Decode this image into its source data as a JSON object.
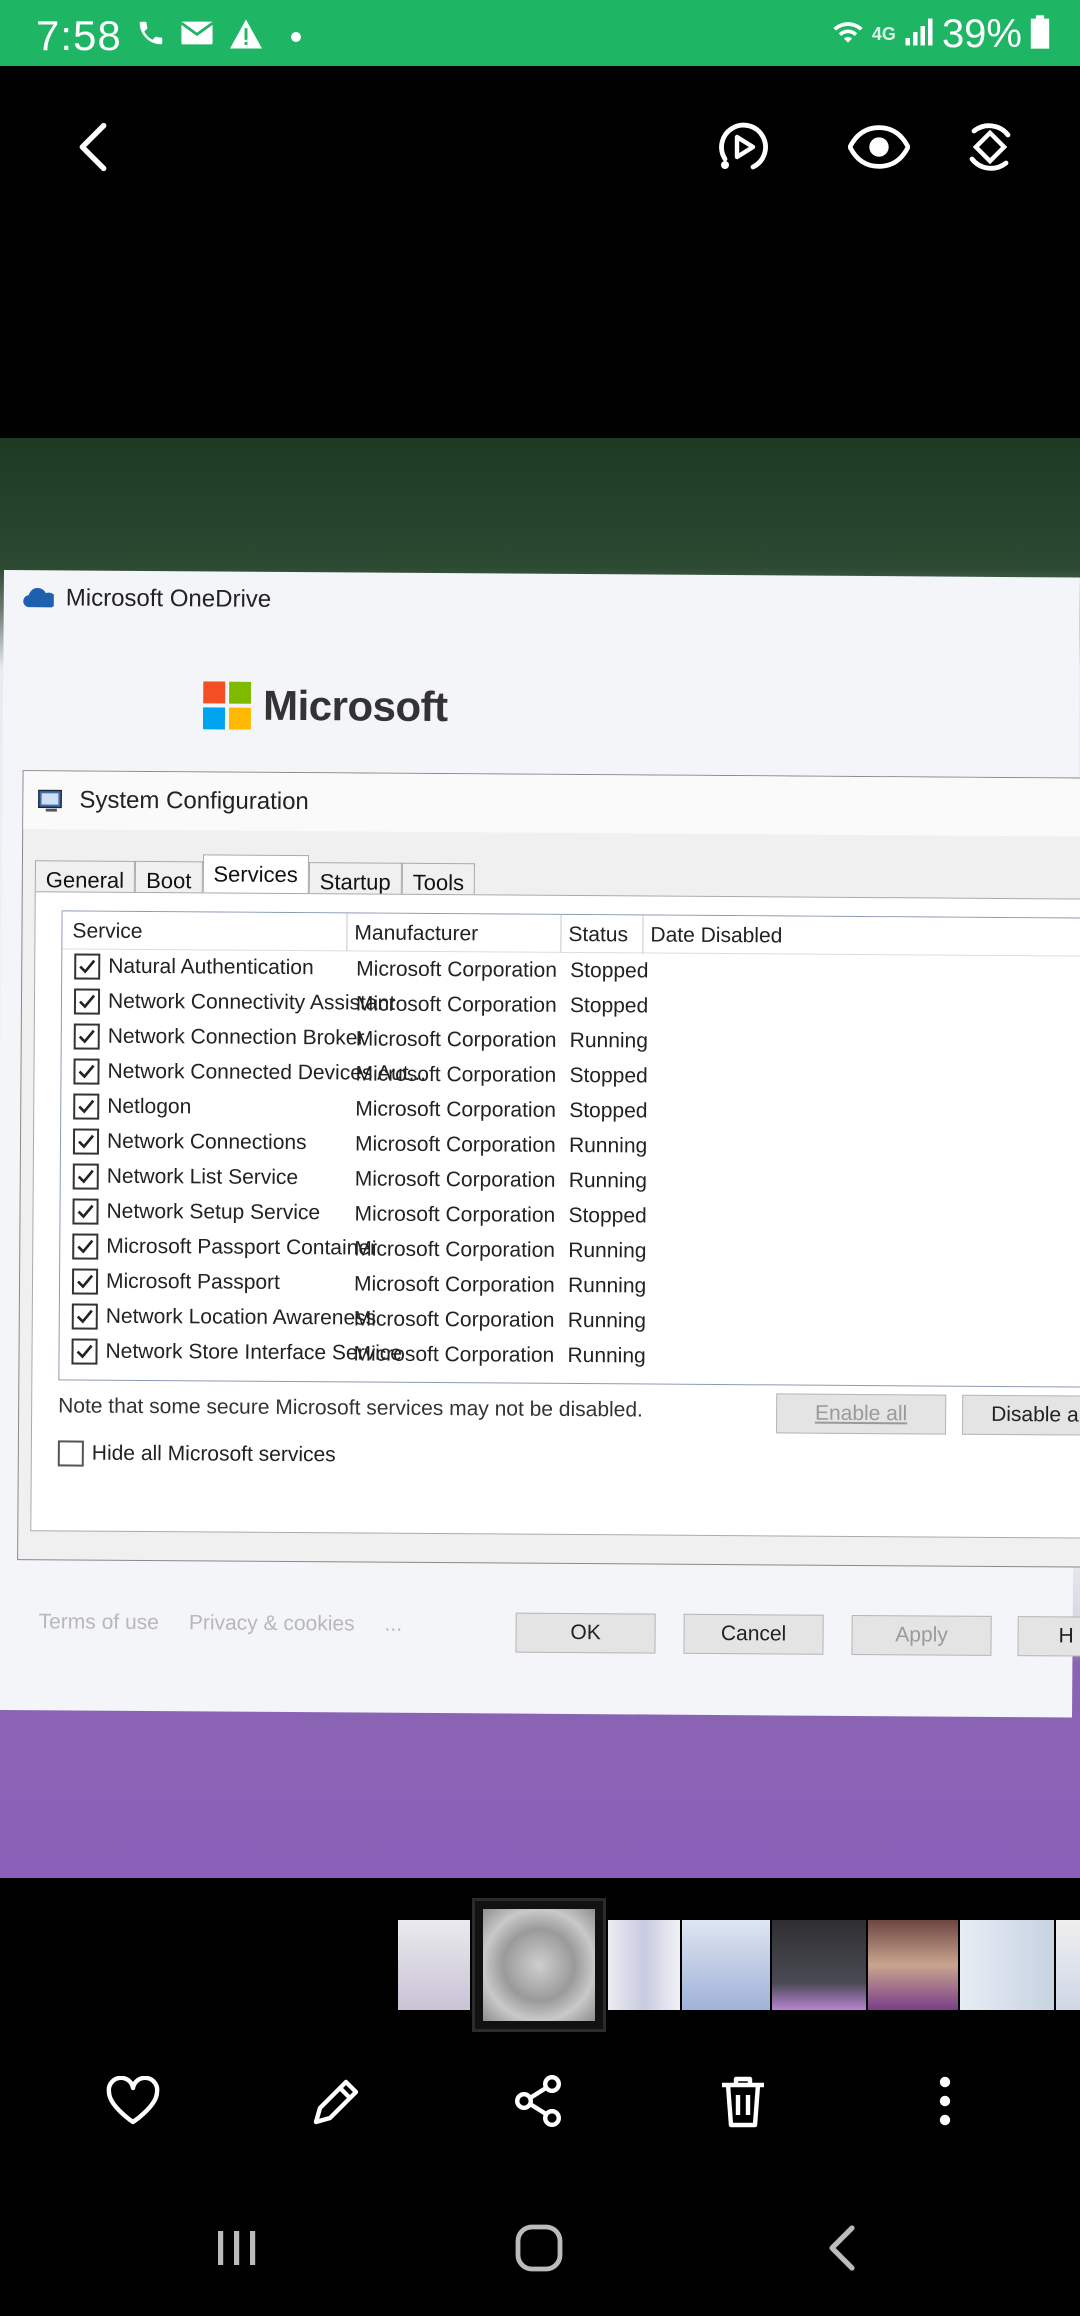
{
  "status_bar": {
    "time": "7:58",
    "network": "4G",
    "battery": "39%"
  },
  "viewer": {
    "back_icon": "chevron-left-icon",
    "actions": [
      "motion-photo-icon",
      "eye-icon",
      "rotate-icon"
    ]
  },
  "photo": {
    "onedrive_title": "Microsoft OneDrive",
    "ms_logo_text": "Microsoft",
    "dialog": {
      "title": "System Configuration",
      "tabs": [
        {
          "label": "General",
          "active": false
        },
        {
          "label": "Boot",
          "active": false
        },
        {
          "label": "Services",
          "active": true
        },
        {
          "label": "Startup",
          "active": false
        },
        {
          "label": "Tools",
          "active": false
        }
      ],
      "columns": [
        "Service",
        "Manufacturer",
        "Status",
        "Date Disabled"
      ],
      "rows": [
        {
          "service": "Natural Authentication",
          "manufacturer": "Microsoft Corporation",
          "status": "Stopped",
          "checked": true
        },
        {
          "service": "Network Connectivity Assistant",
          "manufacturer": "Microsoft Corporation",
          "status": "Stopped",
          "checked": true
        },
        {
          "service": "Network Connection Broker",
          "manufacturer": "Microsoft Corporation",
          "status": "Running",
          "checked": true
        },
        {
          "service": "Network Connected Devices Aut...",
          "manufacturer": "Microsoft Corporation",
          "status": "Stopped",
          "checked": true
        },
        {
          "service": "Netlogon",
          "manufacturer": "Microsoft Corporation",
          "status": "Stopped",
          "checked": true
        },
        {
          "service": "Network Connections",
          "manufacturer": "Microsoft Corporation",
          "status": "Running",
          "checked": true
        },
        {
          "service": "Network List Service",
          "manufacturer": "Microsoft Corporation",
          "status": "Running",
          "checked": true
        },
        {
          "service": "Network Setup Service",
          "manufacturer": "Microsoft Corporation",
          "status": "Stopped",
          "checked": true
        },
        {
          "service": "Microsoft Passport Container",
          "manufacturer": "Microsoft Corporation",
          "status": "Running",
          "checked": true
        },
        {
          "service": "Microsoft Passport",
          "manufacturer": "Microsoft Corporation",
          "status": "Running",
          "checked": true
        },
        {
          "service": "Network Location Awareness",
          "manufacturer": "Microsoft Corporation",
          "status": "Running",
          "checked": true
        },
        {
          "service": "Network Store Interface Service",
          "manufacturer": "Microsoft Corporation",
          "status": "Running",
          "checked": true
        }
      ],
      "note": "Note that some secure Microsoft services may not be disabled.",
      "enable_all": "Enable all",
      "disable_all": "Disable a",
      "hide_ms_label": "Hide all Microsoft services",
      "ok": "OK",
      "cancel": "Cancel",
      "apply": "Apply",
      "help": "H"
    },
    "footer": {
      "terms": "Terms of use",
      "privacy": "Privacy & cookies",
      "more": "..."
    }
  },
  "bottom_actions": [
    "heart-icon",
    "edit-icon",
    "share-icon",
    "delete-icon",
    "more-icon"
  ],
  "nav": [
    "recent-apps-icon",
    "home-icon",
    "back-icon"
  ],
  "colors": {
    "status_bar": "#1eb565",
    "background": "#000000"
  }
}
